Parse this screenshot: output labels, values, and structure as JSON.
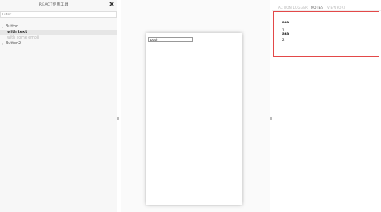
{
  "sidebar": {
    "title": "REACT使用工具",
    "filter": {
      "placeholder": "Filter",
      "value": ""
    },
    "tree": {
      "button": {
        "label": "Button"
      },
      "with_text": {
        "label": "with text"
      },
      "with_some_emoji": {
        "label": "with some emoji"
      },
      "button2": {
        "label": "Button2"
      }
    }
  },
  "preview": {
    "input": {
      "value": "push"
    }
  },
  "panel": {
    "tabs": [
      {
        "label": "ACTION LOGGER",
        "active": false
      },
      {
        "label": "NOTES",
        "active": true
      },
      {
        "label": "VIEWPORT",
        "active": false
      }
    ],
    "notes": {
      "lines": [
        "aaa",
        "1",
        "aaa",
        "2"
      ]
    }
  },
  "colors": {
    "highlight_border": "#e34949",
    "active_story_bg": "#e6e6e6"
  },
  "icons": {
    "shortcuts": "close-x-icon",
    "tree_caret": "caret-down-icon"
  }
}
